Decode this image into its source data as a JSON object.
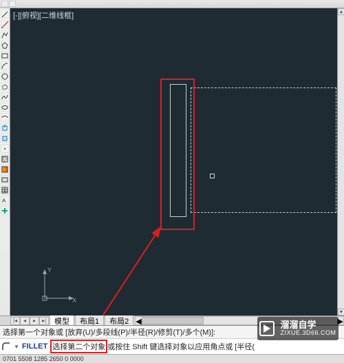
{
  "viewport_label": "[-][俯视][二维线框]",
  "ucs": {
    "x_label": "X",
    "y_label": "Y"
  },
  "tabs": {
    "nav_first": "|◂",
    "nav_prev": "◂",
    "nav_next": "▸",
    "nav_last": "▸|",
    "model": "模型",
    "layout1": "布局1",
    "layout2": "布局2"
  },
  "command": {
    "history": "选择第一个对象或 [放弃(U)/多段线(P)/半径(R)/修剪(T)/多个(M)]:",
    "name": "FILLET",
    "prompt_highlighted": "选择第二个对象",
    "prompt_rest": "或按住 Shift 键选择对象以应用角点或 [半径(",
    "icon_name": "fillet-icon"
  },
  "statusbar": "0701 5508  1285 2650  0 0000",
  "watermark": {
    "line1": "溜溜自学",
    "line2": "ZIXUE.3D66.COM"
  },
  "colors": {
    "canvas_bg": "#1f2b33",
    "highlight": "#d92020",
    "cmd_name": "#1a3aa8"
  }
}
